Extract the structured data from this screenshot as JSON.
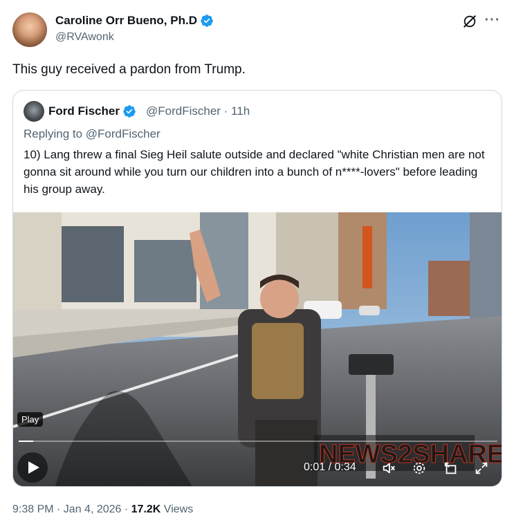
{
  "author": {
    "name": "Caroline Orr Bueno, Ph.D",
    "handle": "@RVAwonk",
    "verified": true
  },
  "tweet": {
    "text": "This guy received a pardon from Trump."
  },
  "quoted": {
    "name": "Ford Fischer",
    "handle_time": "@FordFischer · 11h",
    "replying_to": "Replying to @FordFischer",
    "text": "10) Lang threw a final Sieg Heil salute outside and declared \"white Christian men are not gonna sit around while you turn our children into a bunch of n****-lovers\" before leading his group away."
  },
  "video": {
    "badge": "Play",
    "time": "0:01 / 0:34",
    "watermark": "NEWS2SHARE",
    "progress_fraction": 0.03
  },
  "meta": {
    "timestamp": "9:38 PM · Jan 4, 2026 · ",
    "views_count": "17.2K",
    "views_label": " Views"
  },
  "icons": {
    "verified": "verified-badge-icon",
    "grok": "grok-icon",
    "more": "more-icon",
    "play": "play-icon",
    "volume": "volume-icon",
    "settings": "gear-icon",
    "pip": "picture-in-picture-icon",
    "fullscreen": "fullscreen-icon"
  },
  "colors": {
    "verified_blue": "#1d9bf0",
    "secondary_text": "#536471",
    "border": "#cfd9de"
  }
}
